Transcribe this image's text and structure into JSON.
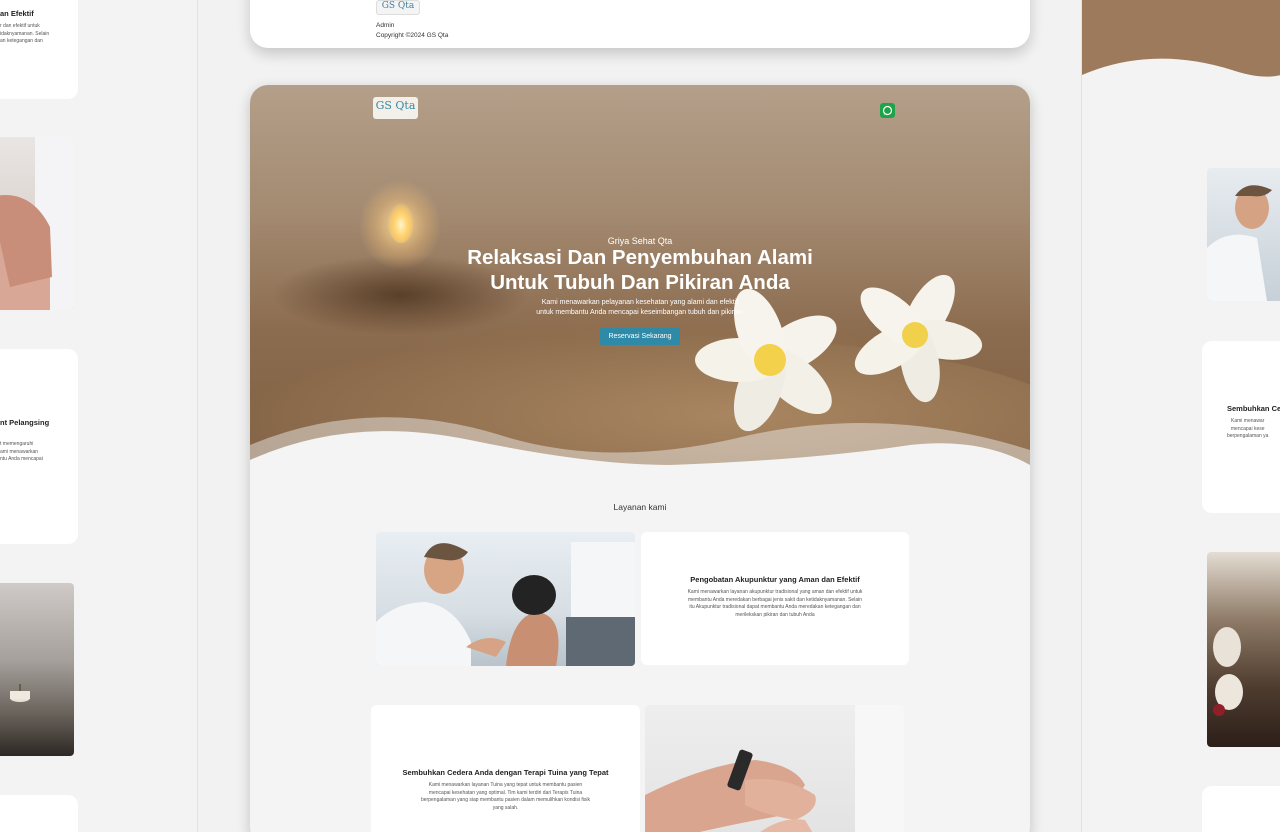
{
  "left_column": {
    "card1": {
      "title": "an Efektif",
      "text": "r dan efektif untuk\nidaknyamanan. Selain\nan ketegangan dan"
    },
    "card3": {
      "title": "nt Pelangsing",
      "text": "t memengaruhi\nami menawarkan\nntu Anda mencapai"
    }
  },
  "top_section": {
    "logo_text": "GS Qta",
    "admin_label": "Admin",
    "copyright": "Copyright ©2024 GS Qta"
  },
  "hero": {
    "logo_text": "GS Qta",
    "subtitle": "Griya Sehat Qta",
    "title_line1": "Relaksasi Dan Penyembuhan Alami",
    "title_line2": "Untuk Tubuh Dan Pikiran Anda",
    "desc_line1": "Kami menawarkan pelayanan kesehatan yang alami dan efektif",
    "desc_line2": "untuk membantu Anda mencapai keseimbangan tubuh dan pikiran.",
    "cta_label": "Reservasi Sekarang",
    "whatsapp_icon": "whatsapp-icon"
  },
  "services": {
    "heading": "Layanan kami",
    "items": [
      {
        "title": "Pengobatan Akupunktur yang Aman dan Efektif",
        "desc": "Kami menawarkan layanan akupunktur tradisional yang aman dan efektif untuk\nmembantu Anda meredakan berbagai jenis sakit dan ketidaknyamanan. Selain\nitu Akupunktur tradisional dapat membantu Anda meredakan ketegangan dan\nmerilekskan pikiran dan tubuh Anda"
      },
      {
        "title": "Sembuhkan Cedera Anda dengan Terapi Tuina yang Tepat",
        "desc": "Kami menawarkan layanan Tuina yang tepat untuk membantu pasien\nmencapai kesehatan yang optimal. Tim kami terdiri dari Terapis Tuina\nberpengalaman yang siap membantu pasien dalam memulihkan kondisi fisik\nyang salah."
      }
    ]
  },
  "right_column": {
    "card": {
      "title": "Sembuhkan Ce",
      "text": "Kami menawar\nmencapai kese\nberpengalaman ya"
    }
  },
  "colors": {
    "accent": "#2e8aa6",
    "whatsapp": "#1fa34a",
    "page_bg": "#f4f4f4"
  }
}
